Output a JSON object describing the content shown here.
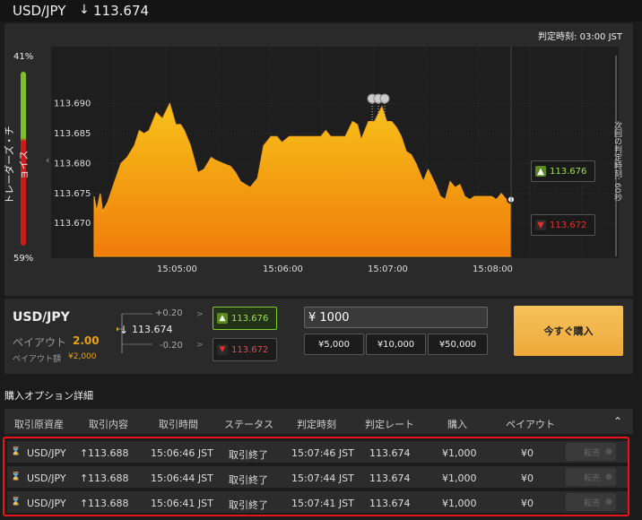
{
  "header": {
    "pair": "USD/JPY",
    "arrow": "↓",
    "rate": "113.674"
  },
  "chart": {
    "judge_time_label": "判定時刻:",
    "judge_time": "03:00 JST",
    "traders_choice_label": "トレーダーズ・チョイス",
    "traders_choice_top": "41%",
    "traders_choice_bottom": "59%",
    "collapse_icon": "‹",
    "next_judge_label": "次回の判定時刻: 60秒",
    "bid_up": "113.676",
    "bid_down": "113.672",
    "colors": {
      "area_top": "#f7c21a",
      "area_bottom": "#f07c0a",
      "up": "#7fc92a",
      "down": "#e0302c"
    }
  },
  "chart_data": {
    "type": "area",
    "y_ticks": [
      "113.690",
      "113.685",
      "113.680",
      "113.675",
      "113.670"
    ],
    "x_ticks": [
      "15:05:00",
      "15:06:00",
      "15:07:00",
      "15:08:00"
    ],
    "ylim": [
      113.6645,
      113.695
    ],
    "xlim_seconds": [
      0,
      226
    ],
    "series": [
      {
        "points": [
          [
            0,
            113.6745
          ],
          [
            2,
            113.672
          ],
          [
            5,
            113.675
          ],
          [
            7,
            113.672
          ],
          [
            11,
            113.6735
          ],
          [
            16,
            113.6765
          ],
          [
            22,
            113.68
          ],
          [
            27,
            113.681
          ],
          [
            33,
            113.683
          ],
          [
            37,
            113.6855
          ],
          [
            41,
            113.685
          ],
          [
            45,
            113.6855
          ],
          [
            51,
            113.6885
          ],
          [
            56,
            113.6875
          ],
          [
            62,
            113.69
          ],
          [
            67,
            113.6865
          ],
          [
            71,
            113.6865
          ],
          [
            74,
            113.6855
          ],
          [
            79,
            113.683
          ],
          [
            85,
            113.6785
          ],
          [
            90,
            113.679
          ],
          [
            96,
            113.681
          ],
          [
            100,
            113.6805
          ],
          [
            106,
            113.68
          ],
          [
            112,
            113.6795
          ],
          [
            116,
            113.6785
          ],
          [
            120,
            113.677
          ],
          [
            128,
            113.676
          ],
          [
            134,
            113.6775
          ],
          [
            139,
            113.683
          ],
          [
            145,
            113.6845
          ],
          [
            150,
            113.6845
          ],
          [
            154,
            113.6835
          ],
          [
            160,
            113.6845
          ],
          [
            166,
            113.6845
          ],
          [
            180,
            113.6845
          ],
          [
            186,
            113.6845
          ],
          [
            190,
            113.6855
          ],
          [
            194,
            113.6845
          ],
          [
            200,
            113.6845
          ],
          [
            206,
            113.6845
          ],
          [
            212,
            113.687
          ],
          [
            216,
            113.6865
          ],
          [
            219,
            113.684
          ],
          [
            225,
            113.687
          ],
          [
            230,
            113.687
          ],
          [
            236,
            113.6895
          ],
          [
            240,
            113.687
          ],
          [
            244,
            113.687
          ],
          [
            248,
            113.686
          ],
          [
            252,
            113.6845
          ],
          [
            256,
            113.682
          ],
          [
            260,
            113.6815
          ],
          [
            264,
            113.68
          ],
          [
            268,
            113.678
          ],
          [
            270,
            113.677
          ],
          [
            274,
            113.679
          ],
          [
            280,
            113.6765
          ],
          [
            284,
            113.6745
          ],
          [
            288,
            113.674
          ],
          [
            292,
            113.677
          ],
          [
            296,
            113.676
          ],
          [
            300,
            113.6765
          ],
          [
            304,
            113.6745
          ],
          [
            308,
            113.674
          ],
          [
            312,
            113.6745
          ],
          [
            316,
            113.6745
          ],
          [
            322,
            113.6745
          ],
          [
            326,
            113.6745
          ],
          [
            330,
            113.674
          ],
          [
            334,
            113.675
          ],
          [
            338,
            113.674
          ],
          [
            342,
            113.674
          ]
        ]
      }
    ],
    "current_rate": 113.674
  },
  "trade": {
    "pair": "USD/JPY",
    "payout_label": "ペイアウト",
    "payout": "2.00",
    "amount_label": "ペイアウト額",
    "amount": "¥2,000",
    "up_offset": "+0.20",
    "down_offset": "-0.20",
    "current_arrow": "↓",
    "current": "113.674",
    "buy_up": "113.676",
    "buy_down": "113.672",
    "investment": "¥ 1000",
    "preset_1": "¥5,000",
    "preset_2": "¥10,000",
    "preset_3": "¥50,000",
    "buy_now": "今すぐ購入"
  },
  "details": {
    "title": "購入オプション詳細",
    "headers": [
      "取引原資産",
      "取引内容",
      "取引時間",
      "ステータス",
      "判定時刻",
      "判定レート",
      "購入",
      "ペイアウト"
    ],
    "resale_label": "転売",
    "rows": [
      {
        "asset": "USD/JPY",
        "arrow": "↑",
        "content": "113.688",
        "time": "15:06:46 JST",
        "status": "取引終了",
        "judge": "15:07:46 JST",
        "rate": "113.674",
        "purchase": "¥1,000",
        "payout": "¥0"
      },
      {
        "asset": "USD/JPY",
        "arrow": "↑",
        "content": "113.688",
        "time": "15:06:44 JST",
        "status": "取引終了",
        "judge": "15:07:44 JST",
        "rate": "113.674",
        "purchase": "¥1,000",
        "payout": "¥0"
      },
      {
        "asset": "USD/JPY",
        "arrow": "↑",
        "content": "113.688",
        "time": "15:06:41 JST",
        "status": "取引終了",
        "judge": "15:07:41 JST",
        "rate": "113.674",
        "purchase": "¥1,000",
        "payout": "¥0"
      }
    ]
  }
}
